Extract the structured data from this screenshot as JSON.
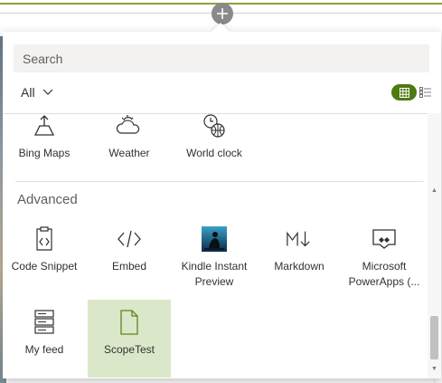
{
  "panel": {
    "search_placeholder": "Search",
    "filter_label": "All",
    "view_toggle": {
      "grid": "grid-view-icon",
      "list": "list-view-icon"
    }
  },
  "top_row": [
    {
      "label": "Bing Maps",
      "icon": "map-pin-icon"
    },
    {
      "label": "Weather",
      "icon": "weather-icon"
    },
    {
      "label": "World clock",
      "icon": "world-clock-icon"
    }
  ],
  "advanced": {
    "title": "Advanced",
    "items": [
      {
        "label": "Code Snippet",
        "icon": "code-snippet-icon"
      },
      {
        "label": "Embed",
        "icon": "embed-icon"
      },
      {
        "label": "Kindle Instant Preview",
        "icon": "kindle-icon"
      },
      {
        "label": "Markdown",
        "icon": "markdown-icon"
      },
      {
        "label": "Microsoft PowerApps (...",
        "icon": "powerapps-icon"
      },
      {
        "label": "My feed",
        "icon": "feed-icon"
      },
      {
        "label": "ScopeTest",
        "icon": "document-icon"
      }
    ]
  },
  "colors": {
    "accent": "#4e7a12",
    "selected_bg": "#dbe7c9",
    "divider": "#8da23a"
  }
}
